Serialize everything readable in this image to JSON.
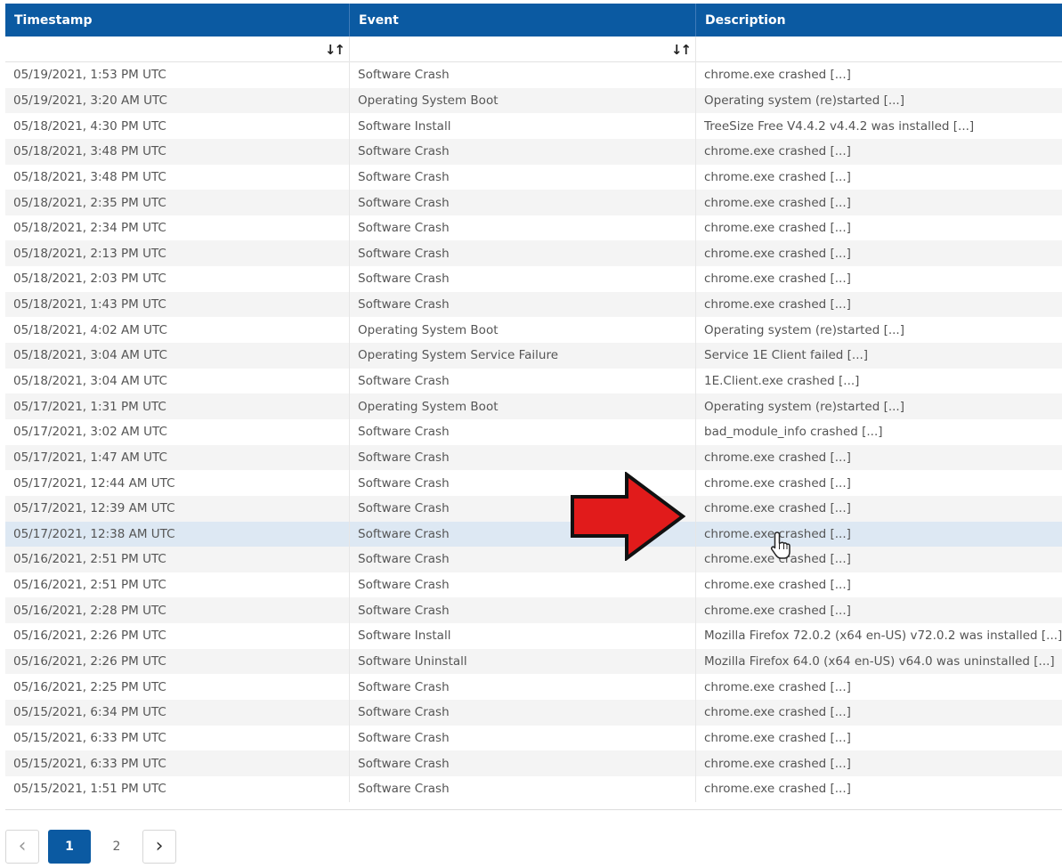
{
  "table": {
    "columns": [
      "Timestamp",
      "Event",
      "Description"
    ],
    "sort_icon": "↓↑",
    "rows": [
      [
        "05/19/2021, 1:53 PM UTC",
        "Software Crash",
        "chrome.exe crashed [...]"
      ],
      [
        "05/19/2021, 3:20 AM UTC",
        "Operating System Boot",
        "Operating system (re)started [...]"
      ],
      [
        "05/18/2021, 4:30 PM UTC",
        "Software Install",
        "TreeSize Free V4.4.2 v4.4.2 was installed [...]"
      ],
      [
        "05/18/2021, 3:48 PM UTC",
        "Software Crash",
        "chrome.exe crashed [...]"
      ],
      [
        "05/18/2021, 3:48 PM UTC",
        "Software Crash",
        "chrome.exe crashed [...]"
      ],
      [
        "05/18/2021, 2:35 PM UTC",
        "Software Crash",
        "chrome.exe crashed [...]"
      ],
      [
        "05/18/2021, 2:34 PM UTC",
        "Software Crash",
        "chrome.exe crashed [...]"
      ],
      [
        "05/18/2021, 2:13 PM UTC",
        "Software Crash",
        "chrome.exe crashed [...]"
      ],
      [
        "05/18/2021, 2:03 PM UTC",
        "Software Crash",
        "chrome.exe crashed [...]"
      ],
      [
        "05/18/2021, 1:43 PM UTC",
        "Software Crash",
        "chrome.exe crashed [...]"
      ],
      [
        "05/18/2021, 4:02 AM UTC",
        "Operating System Boot",
        "Operating system (re)started [...]"
      ],
      [
        "05/18/2021, 3:04 AM UTC",
        "Operating System Service Failure",
        "Service 1E Client failed [...]"
      ],
      [
        "05/18/2021, 3:04 AM UTC",
        "Software Crash",
        "1E.Client.exe crashed [...]"
      ],
      [
        "05/17/2021, 1:31 PM UTC",
        "Operating System Boot",
        "Operating system (re)started [...]"
      ],
      [
        "05/17/2021, 3:02 AM UTC",
        "Software Crash",
        "bad_module_info crashed [...]"
      ],
      [
        "05/17/2021, 1:47 AM UTC",
        "Software Crash",
        "chrome.exe crashed [...]"
      ],
      [
        "05/17/2021, 12:44 AM UTC",
        "Software Crash",
        "chrome.exe crashed [...]"
      ],
      [
        "05/17/2021, 12:39 AM UTC",
        "Software Crash",
        "chrome.exe crashed [...]"
      ],
      [
        "05/17/2021, 12:38 AM UTC",
        "Software Crash",
        "chrome.exe crashed [...]"
      ],
      [
        "05/16/2021, 2:51 PM UTC",
        "Software Crash",
        "chrome.exe crashed [...]"
      ],
      [
        "05/16/2021, 2:51 PM UTC",
        "Software Crash",
        "chrome.exe crashed [...]"
      ],
      [
        "05/16/2021, 2:28 PM UTC",
        "Software Crash",
        "chrome.exe crashed [...]"
      ],
      [
        "05/16/2021, 2:26 PM UTC",
        "Software Install",
        "Mozilla Firefox 72.0.2 (x64 en-US) v72.0.2 was installed [...]"
      ],
      [
        "05/16/2021, 2:26 PM UTC",
        "Software Uninstall",
        "Mozilla Firefox 64.0 (x64 en-US) v64.0 was uninstalled [...]"
      ],
      [
        "05/16/2021, 2:25 PM UTC",
        "Software Crash",
        "chrome.exe crashed [...]"
      ],
      [
        "05/15/2021, 6:34 PM UTC",
        "Software Crash",
        "chrome.exe crashed [...]"
      ],
      [
        "05/15/2021, 6:33 PM UTC",
        "Software Crash",
        "chrome.exe crashed [...]"
      ],
      [
        "05/15/2021, 6:33 PM UTC",
        "Software Crash",
        "chrome.exe crashed [...]"
      ],
      [
        "05/15/2021, 1:51 PM UTC",
        "Software Crash",
        "chrome.exe crashed [...]"
      ]
    ],
    "selected_row": 18
  },
  "pagination": {
    "prev_icon": "‹",
    "pages": [
      "1",
      "2"
    ],
    "active_page": "1",
    "next_icon": "›"
  },
  "colors": {
    "header_bg": "#0b5aa2",
    "selected_row_bg": "#dde8f3",
    "arrow_fill": "#e11b1b"
  },
  "overlay": {
    "arrow_icon": "red-right-arrow-icon",
    "cursor_icon": "hand-pointer-icon"
  }
}
